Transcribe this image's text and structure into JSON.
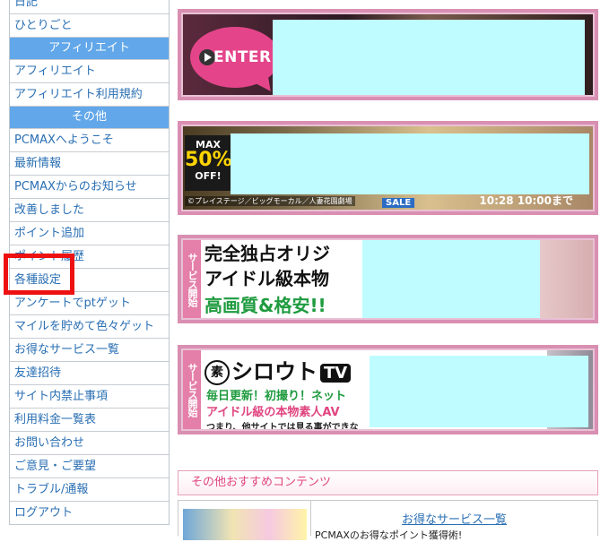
{
  "sidebar": {
    "items_top": [
      "日記",
      "ひとりごと"
    ],
    "header_affiliate": "アフィリエイト",
    "items_affiliate": [
      "アフィリエイト",
      "アフィリエイト利用規約"
    ],
    "header_other": "その他",
    "items_other": [
      "PCMAXへようこそ",
      "最新情報",
      "PCMAXからのお知らせ",
      "改善しました",
      "ポイント追加",
      "ポイント履歴",
      "各種設定",
      "アンケートでptゲット",
      "マイルを貯めて色々ゲット",
      "お得なサービス一覧",
      "友達招待",
      "サイト内禁止事項",
      "利用料金一覧表",
      "お問い合わせ",
      "ご意見・ご要望",
      "トラブル/通報",
      "ログアウト"
    ]
  },
  "banners": {
    "enter_label": "ENTER",
    "max_label": "MAX",
    "discount": "50%",
    "off_label": "OFF!",
    "copyright": "©プレイステージ／ビッグモーカル／人妻花園劇場",
    "sale_label": "SALE",
    "date_text": "10:28 10:00まで",
    "service_tab": "サービス開始",
    "b3_line1": "完全独占オリジ",
    "b3_line2": "アイドル級本物",
    "b3_line3": "高画質&格安!!",
    "shirouto_mark": "素",
    "shirouto_name": "シロウト",
    "shirouto_tv": "TV",
    "b4_line1": "毎日更新！初撮り！ネット",
    "b4_line2": "アイドル級の本物素人AV",
    "b4_line3": "つまり、他サイトでは見る事ができな"
  },
  "section": {
    "title": "その他おすすめコンテンツ",
    "link": "お得なサービス一覧",
    "desc": "PCMAXのお得なポイント獲得術!"
  },
  "colors": {
    "link": "#2a6fb3",
    "header_bg": "#62a7e9",
    "highlight": "#ee1111",
    "banner_border": "#d98fb2",
    "redaction": "#bffcff"
  }
}
